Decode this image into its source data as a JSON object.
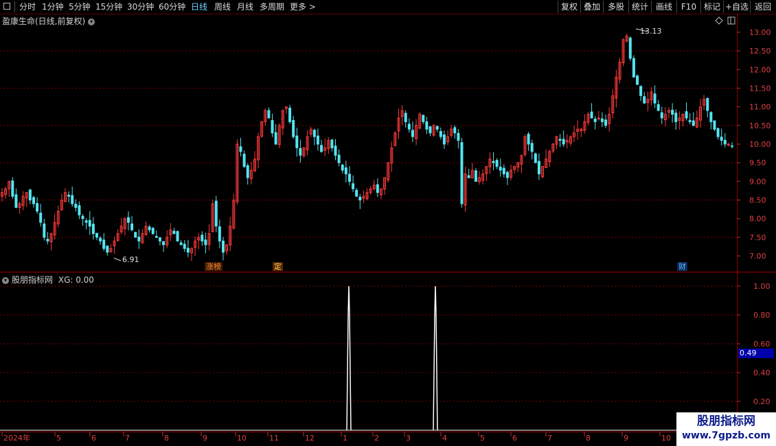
{
  "toolbar": {
    "periods": [
      "分时",
      "1分钟",
      "5分钟",
      "15分钟",
      "30分钟",
      "60分钟",
      "日线",
      "周线",
      "月线",
      "多周期",
      "更多 >"
    ],
    "active_period": "日线",
    "right_buttons": [
      "复权",
      "叠加",
      "多股",
      "统计",
      "画线",
      "F10",
      "标记",
      "+自选",
      "返回"
    ]
  },
  "main_panel": {
    "title": "盈康生命(日线,前复权)",
    "price_axis": [
      "13.00",
      "12.50",
      "12.00",
      "11.50",
      "11.00",
      "10.50",
      "10.00",
      "9.50",
      "9.00",
      "8.50",
      "8.00",
      "7.50",
      "7.00"
    ],
    "high_label": "13.13",
    "low_label": "6.91",
    "markers": [
      {
        "text": "涨榜",
        "color": "#ff8a3c"
      },
      {
        "text": "定",
        "color": "#ffd060"
      },
      {
        "text": "财",
        "color": "#60b0ff"
      }
    ],
    "colors": {
      "up": "#ff3a3a",
      "down": "#54e4f0",
      "grid": "#7a0000"
    }
  },
  "indicator_panel": {
    "title": "股朋指标网",
    "value_label": "XG: 0.00",
    "axis": [
      "1.00",
      "0.80",
      "0.60",
      "0.40",
      "0.20"
    ],
    "current_value": "0.49",
    "signal_color": "#ffffff"
  },
  "date_axis": [
    "2024年",
    "5",
    "6",
    "7",
    "8",
    "9",
    "10",
    "11",
    "12",
    "1",
    "2",
    "3",
    "4",
    "5",
    "6",
    "7",
    "8",
    "9",
    "10"
  ],
  "watermark": {
    "line1": "股朋指标网",
    "line2": "www.7gpzb.com"
  },
  "chart_data": {
    "type": "candlestick",
    "price_range": [
      6.7,
      13.3
    ],
    "closes": [
      8.7,
      8.8,
      9.0,
      8.6,
      8.3,
      8.4,
      8.6,
      8.7,
      8.5,
      8.4,
      8.2,
      7.9,
      7.5,
      7.4,
      7.6,
      7.9,
      8.2,
      8.5,
      8.7,
      8.6,
      8.4,
      8.3,
      8.1,
      8.0,
      7.9,
      7.8,
      7.6,
      7.5,
      7.4,
      7.2,
      7.1,
      7.2,
      7.4,
      7.6,
      7.8,
      8.0,
      7.9,
      7.7,
      7.5,
      7.4,
      7.6,
      7.8,
      7.7,
      7.6,
      7.5,
      7.4,
      7.3,
      7.5,
      7.7,
      7.6,
      7.4,
      7.3,
      7.2,
      7.1,
      7.2,
      7.4,
      7.5,
      7.4,
      7.3,
      7.6,
      8.4,
      7.8,
      7.4,
      7.1,
      7.3,
      7.8,
      8.5,
      10.0,
      9.8,
      9.4,
      9.1,
      9.3,
      9.6,
      10.2,
      10.6,
      10.9,
      10.7,
      10.3,
      10.0,
      10.5,
      10.9,
      11.0,
      10.6,
      10.2,
      9.9,
      9.7,
      9.9,
      10.2,
      10.4,
      10.2,
      10.0,
      9.8,
      9.9,
      10.1,
      9.9,
      9.7,
      9.5,
      9.3,
      9.2,
      9.0,
      8.8,
      8.6,
      8.5,
      8.6,
      8.7,
      8.8,
      8.9,
      8.7,
      8.8,
      9.1,
      9.5,
      9.9,
      10.3,
      10.7,
      10.9,
      10.6,
      10.4,
      10.2,
      10.5,
      10.8,
      10.6,
      10.4,
      10.3,
      10.5,
      10.4,
      10.2,
      10.0,
      10.2,
      10.4,
      10.3,
      10.1,
      8.4,
      9.2,
      9.1,
      9.3,
      9.0,
      9.1,
      9.2,
      9.4,
      9.6,
      9.5,
      9.4,
      9.3,
      9.2,
      9.1,
      9.3,
      9.4,
      9.5,
      9.7,
      10.2,
      10.0,
      9.8,
      9.5,
      9.2,
      9.4,
      9.6,
      9.8,
      10.0,
      10.2,
      10.1,
      10.0,
      10.1,
      10.2,
      10.3,
      10.4,
      10.4,
      10.6,
      10.8,
      10.7,
      10.6,
      10.7,
      10.6,
      10.5,
      10.8,
      11.3,
      11.8,
      12.2,
      12.8,
      12.9,
      12.3,
      11.8,
      11.6,
      11.3,
      11.1,
      11.2,
      11.4,
      11.1,
      10.9,
      10.7,
      10.8,
      10.9,
      10.8,
      10.6,
      10.7,
      10.8,
      10.7,
      10.6,
      10.5,
      10.7,
      11.0,
      11.2,
      10.9,
      10.6,
      10.4,
      10.2,
      10.1,
      10.0,
      10.0,
      9.95
    ]
  }
}
